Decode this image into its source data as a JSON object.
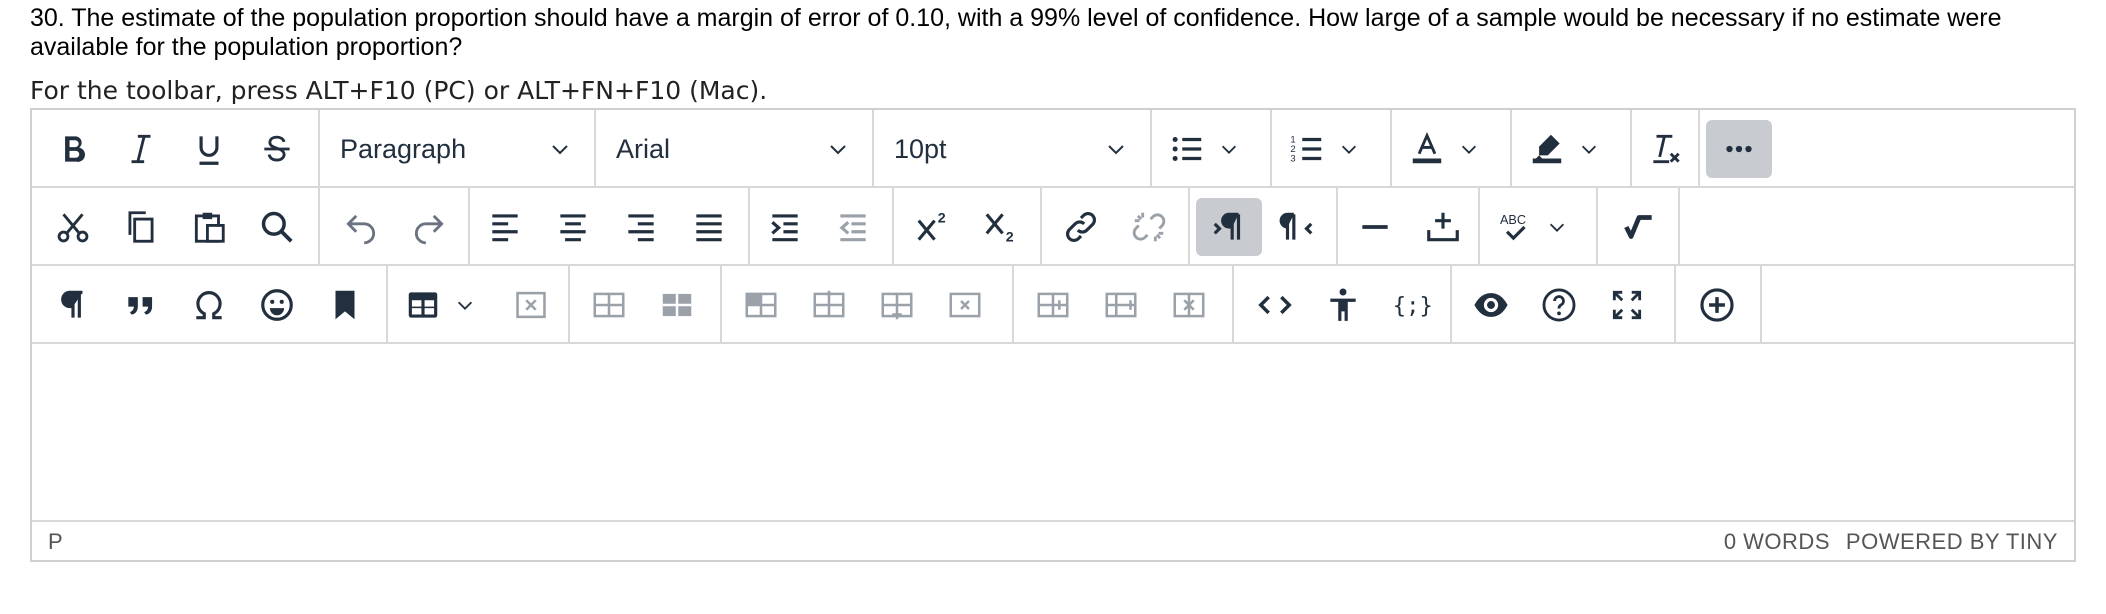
{
  "question": {
    "text": "30. The estimate of the population proportion should have a margin of error of 0.10, with a 99% level of confidence. How large of a sample would be necessary if no estimate were available for the population proportion?"
  },
  "toolbar_hint": "For the toolbar, press ALT+F10 (PC) or ALT+FN+F10 (Mac).",
  "toolbar": {
    "block_format": "Paragraph",
    "font_family": "Arial",
    "font_size": "10pt",
    "icons": {
      "row1": [
        "bold-icon",
        "italic-icon",
        "underline-icon",
        "strikethrough-icon",
        "bullet-list-icon",
        "numbered-list-icon",
        "text-color-icon",
        "highlight-color-icon",
        "clear-formatting-icon",
        "more-icon"
      ],
      "row2": [
        "cut-icon",
        "copy-icon",
        "paste-icon",
        "find-icon",
        "undo-icon",
        "redo-icon",
        "align-left-icon",
        "align-center-icon",
        "align-right-icon",
        "justify-icon",
        "indent-icon",
        "outdent-icon",
        "superscript-icon",
        "subscript-icon",
        "link-icon",
        "unlink-icon",
        "ltr-icon",
        "rtl-icon",
        "horizontal-line-icon",
        "insert-anchor-icon",
        "spellcheck-icon",
        "math-equation-icon"
      ],
      "row3": [
        "show-blocks-icon",
        "blockquote-icon",
        "special-character-icon",
        "emoji-icon",
        "bookmark-icon",
        "table-icon",
        "delete-table-icon",
        "table-row-before-icon",
        "table-row-after-icon",
        "table-cell-icon",
        "insert-column-before-icon",
        "insert-column-after-icon",
        "delete-column-icon",
        "insert-row-icon",
        "insert-row-after-icon",
        "delete-row-icon",
        "source-code-icon",
        "accessibility-icon",
        "code-sample-icon",
        "preview-icon",
        "help-icon",
        "fullscreen-icon",
        "add-content-icon"
      ]
    },
    "colors": {
      "text_color_bar": "#222f3e",
      "accent_active": "#c8cbcf"
    }
  },
  "statusbar": {
    "path": "P",
    "word_count": "0 WORDS",
    "brand": "POWERED BY TINY"
  }
}
